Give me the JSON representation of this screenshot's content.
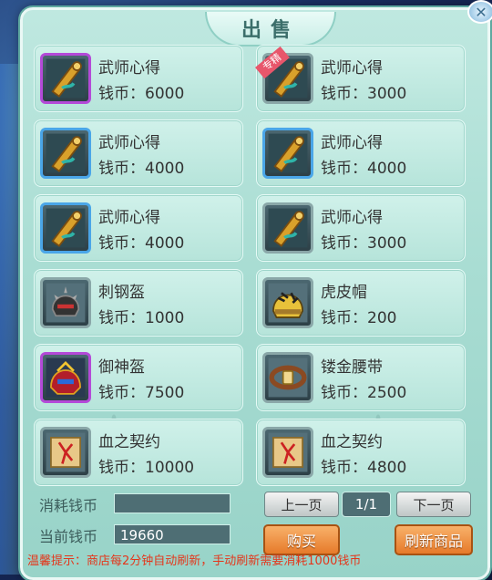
{
  "title": "出售",
  "currency_label": "钱币：",
  "items": [
    {
      "name": "武师心得",
      "price": "6000",
      "quality": "purple",
      "icon": "scroll-icon",
      "badge": ""
    },
    {
      "name": "武师心得",
      "price": "3000",
      "quality": "gray",
      "icon": "scroll-icon",
      "badge": "专精"
    },
    {
      "name": "武师心得",
      "price": "4000",
      "quality": "blue",
      "icon": "scroll-icon",
      "badge": ""
    },
    {
      "name": "武师心得",
      "price": "4000",
      "quality": "blue",
      "icon": "scroll-icon",
      "badge": ""
    },
    {
      "name": "武师心得",
      "price": "4000",
      "quality": "blue",
      "icon": "scroll-icon",
      "badge": ""
    },
    {
      "name": "武师心得",
      "price": "3000",
      "quality": "gray",
      "icon": "scroll-icon",
      "badge": ""
    },
    {
      "name": "刺钢盔",
      "price": "1000",
      "quality": "gray",
      "icon": "spiked-helmet-icon",
      "badge": ""
    },
    {
      "name": "虎皮帽",
      "price": "200",
      "quality": "gray",
      "icon": "tiger-hat-icon",
      "badge": ""
    },
    {
      "name": "御神盔",
      "price": "7500",
      "quality": "purple",
      "icon": "divine-helmet-icon",
      "badge": ""
    },
    {
      "name": "镂金腰带",
      "price": "2500",
      "quality": "gray",
      "icon": "belt-icon",
      "badge": ""
    },
    {
      "name": "血之契约",
      "price": "10000",
      "quality": "gray",
      "icon": "blood-contract-icon",
      "badge": ""
    },
    {
      "name": "血之契约",
      "price": "4800",
      "quality": "gray",
      "icon": "blood-contract-icon",
      "badge": ""
    }
  ],
  "footer": {
    "cost_label": "消耗钱币",
    "cost_value": "",
    "current_label": "当前钱币",
    "current_value": "19660",
    "prev_page": "上一页",
    "page_indicator": "1/1",
    "next_page": "下一页",
    "buy": "购买",
    "refresh": "刷新商品",
    "tip": "温馨提示：商店每2分钟自动刷新，手动刷新需要消耗1000钱币"
  },
  "colors": {
    "panel": "#a9ddd3",
    "purple_quality": "#b44ad8",
    "blue_quality": "#4aa6e8",
    "action_button": "#e67a2a",
    "tip_text": "#e4361b"
  }
}
